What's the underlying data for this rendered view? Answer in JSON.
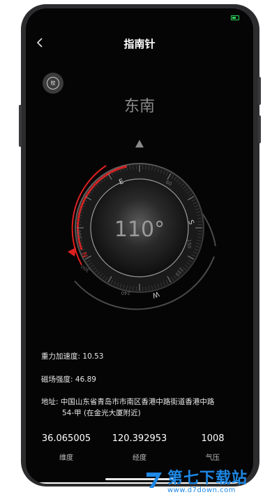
{
  "header": {
    "back_icon": "chevron-left-icon",
    "title": "指南针"
  },
  "calibrate": {
    "label": "校"
  },
  "compass": {
    "direction": "东南",
    "heading_text": "110°",
    "heading_deg": 110,
    "cardinals": [
      "E",
      "S",
      "W",
      "N"
    ],
    "numbers": [
      "150",
      "210",
      "240",
      "300",
      "330",
      "60"
    ]
  },
  "info": {
    "gravity_label": "重力加速度: ",
    "gravity_value": "10.53",
    "magnetic_label": "磁场强度: ",
    "magnetic_value": "46.89",
    "address_label": "地址: ",
    "address_line1": "中国山东省青岛市市南区香港中路街道香港中路",
    "address_line2": "54-甲 (在金光大厦附近)"
  },
  "stats": [
    {
      "value": "36.065005",
      "label": "维度"
    },
    {
      "value": "120.392953",
      "label": "经度"
    },
    {
      "value": "1008",
      "label": "气压"
    }
  ],
  "watermark": {
    "title": "第七下载站",
    "url": "www.d7down.com"
  },
  "colors": {
    "accent_red": "#e02020",
    "background": "#050505"
  }
}
